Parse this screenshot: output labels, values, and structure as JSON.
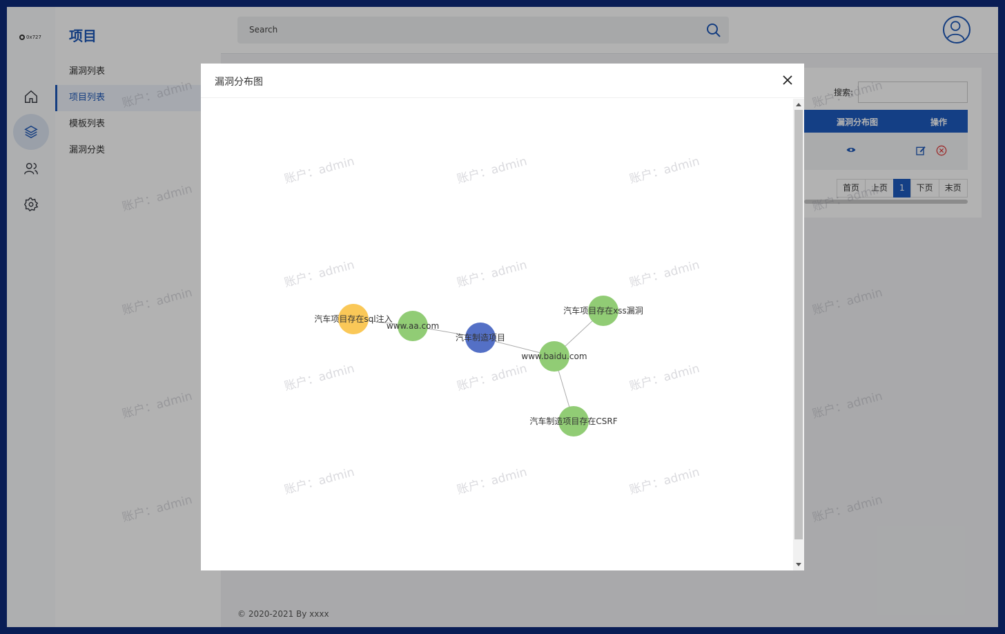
{
  "logo": {
    "text": "0x727"
  },
  "rail": {
    "items": [
      "home-icon",
      "layers-icon",
      "users-icon",
      "gear-icon"
    ],
    "active": "layers-icon"
  },
  "subnav": {
    "title": "项目",
    "items": [
      {
        "label": "漏洞列表"
      },
      {
        "label": "项目列表",
        "active": true
      },
      {
        "label": "模板列表"
      },
      {
        "label": "漏洞分类"
      }
    ]
  },
  "topbar": {
    "search_placeholder": "Search"
  },
  "card": {
    "search_label": "搜索:",
    "columns": [
      "漏洞分布图",
      "操作"
    ],
    "pager": [
      "首页",
      "上页",
      "1",
      "下页",
      "末页"
    ],
    "pager_current": "1"
  },
  "footer": {
    "text": "© 2020-2021 By xxxx"
  },
  "watermark": {
    "text": "账户：admin"
  },
  "modal": {
    "title": "漏洞分布图",
    "graph": {
      "nodes": [
        {
          "id": "root",
          "label": "汽车制造项目",
          "color": "#5470c6",
          "label_color": "#ffffff"
        },
        {
          "id": "aa",
          "label": "www.aa.com",
          "color": "#91cc75"
        },
        {
          "id": "sql",
          "label": "汽车项目存在sql注入",
          "color": "#fac858"
        },
        {
          "id": "baidu",
          "label": "www.baidu.com",
          "color": "#91cc75"
        },
        {
          "id": "xss",
          "label": "汽车项目存在xss漏洞",
          "color": "#91cc75"
        },
        {
          "id": "csrf",
          "label": "汽车制造项目存在CSRF",
          "color": "#91cc75"
        }
      ],
      "edges": [
        {
          "from": "root",
          "to": "aa"
        },
        {
          "from": "aa",
          "to": "sql"
        },
        {
          "from": "root",
          "to": "baidu"
        },
        {
          "from": "baidu",
          "to": "xss"
        },
        {
          "from": "baidu",
          "to": "csrf"
        }
      ]
    }
  }
}
